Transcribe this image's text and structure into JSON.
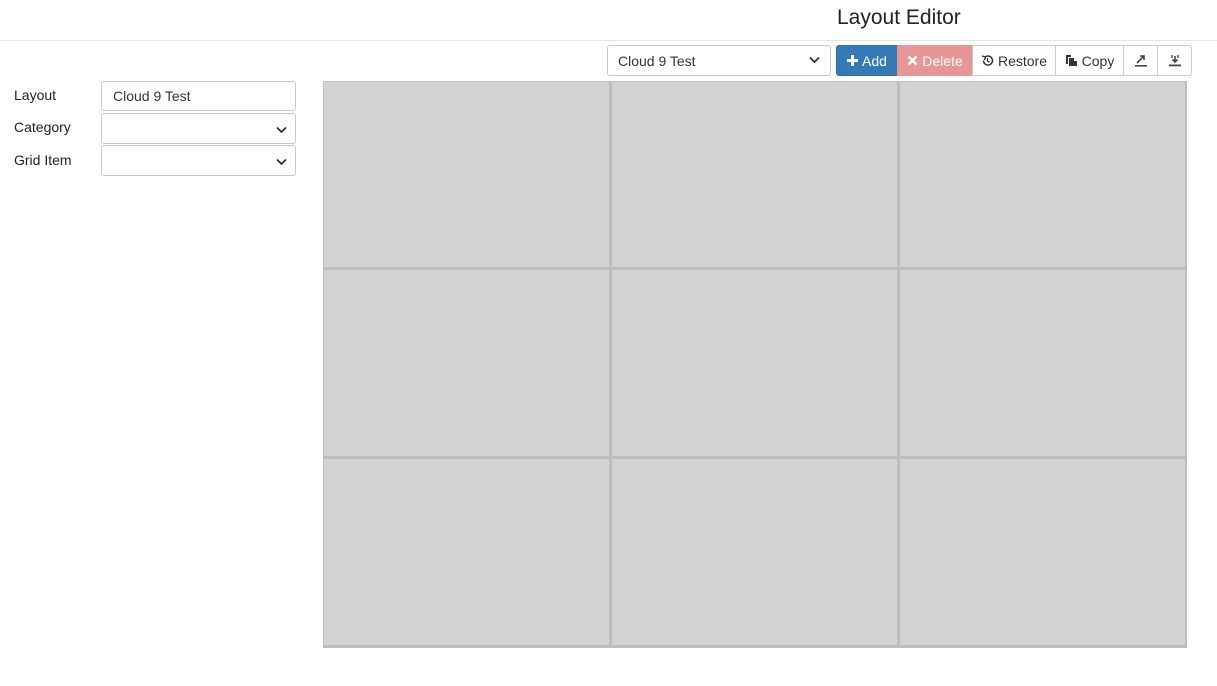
{
  "header": {
    "title": "Layout Editor"
  },
  "toolbar": {
    "layout_select_value": "Cloud 9 Test",
    "add_label": "Add",
    "delete_label": "Delete",
    "restore_label": "Restore",
    "copy_label": "Copy",
    "export_icon": "export-icon",
    "import_icon": "import-icon"
  },
  "form": {
    "layout_label": "Layout",
    "layout_value": "Cloud 9 Test",
    "category_label": "Category",
    "category_value": "",
    "grid_item_label": "Grid Item",
    "grid_item_value": ""
  },
  "grid": {
    "rows": 3,
    "columns": 3
  },
  "colors": {
    "add_button": "#337ab7",
    "delete_button": "#e69695",
    "grid_cell": "#d3d3d3",
    "grid_border": "#bdbdbd"
  }
}
